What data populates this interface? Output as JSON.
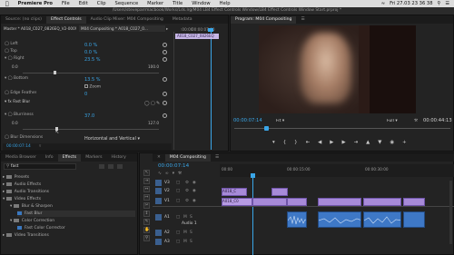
{
  "menubar": {
    "app": "Premiere Pro",
    "items": [
      "File",
      "Edit",
      "Clip",
      "Sequence",
      "Marker",
      "Title",
      "Window",
      "Help"
    ],
    "clock": "Fri 27.03  23 36 38"
  },
  "path": "/Users/steveparrmacbook/Works/Lds.lrg/M04 LB4 Effect Controls Window/LB4 Effect Controls Window Start.prproj *",
  "effect_controls": {
    "tabs": [
      "Source: (no clips)",
      "Effect Controls",
      "Audio Clip Mixer: M04 Compositing",
      "Metadata"
    ],
    "header_master": "Master * A018_C027_0826EQ_V2-0009...",
    "header_seq": "M04 Compositing * A018_C027_0...",
    "timecode_head": ":00:00",
    "timecode_mark": "00:00:07:00",
    "clip_label": "A018_C027_0826EQ",
    "rows": {
      "left_label": "Left",
      "left_val": "0.0 %",
      "top_label": "Top",
      "top_val": "0.0 %",
      "right_label": "Right",
      "right_val": "23.5 %",
      "right_min": "0.0",
      "right_max": "100.0",
      "bottom_label": "Bottom",
      "bottom_val": "13.5 %",
      "zoom_label": "Zoom",
      "edge_label": "Edge Feather",
      "edge_val": "0",
      "fast_blur_label": "Fast Blur",
      "blurriness_label": "Blurriness",
      "blurriness_val": "37.0",
      "blur_min": "0.0",
      "blur_max": "127.0",
      "blur_dim_label": "Blur Dimensions",
      "blur_dim_val": "Horizontal and Vertical"
    },
    "bottom_timecode": "00:00:07:14"
  },
  "program": {
    "title": "Program: M04 Compositing",
    "timecode": "00:00:07:14",
    "fit": "Fit",
    "quality": "Full",
    "duration": "00:00:44:13"
  },
  "effects_panel": {
    "tabs": [
      "Media Browser",
      "Info",
      "Effects",
      "Markers",
      "History"
    ],
    "search": "fast",
    "tree": [
      "Presets",
      "Audio Effects",
      "Audio Transitions",
      "Video Effects",
      "Blur & Sharpen",
      "Fast Blur",
      "Color Correction",
      "Fast Color Corrector",
      "Video Transitions"
    ]
  },
  "timeline": {
    "title": "M04 Compositing",
    "timecode": "00:00:07:14",
    "ruler": [
      "00:00",
      "00:00:15:00",
      "00:00:30:00"
    ],
    "tracks": [
      "V3",
      "V2",
      "V1",
      "A1",
      "A2",
      "A3"
    ],
    "track_name_a1": "Audio 1",
    "clips": [
      "A018_C",
      "A018_C0"
    ]
  },
  "colors": {
    "accent": "#3aa6e8",
    "video_clip": "#a78ad8",
    "audio_clip": "#3e78c6",
    "playhead": "#3aa6e8"
  }
}
